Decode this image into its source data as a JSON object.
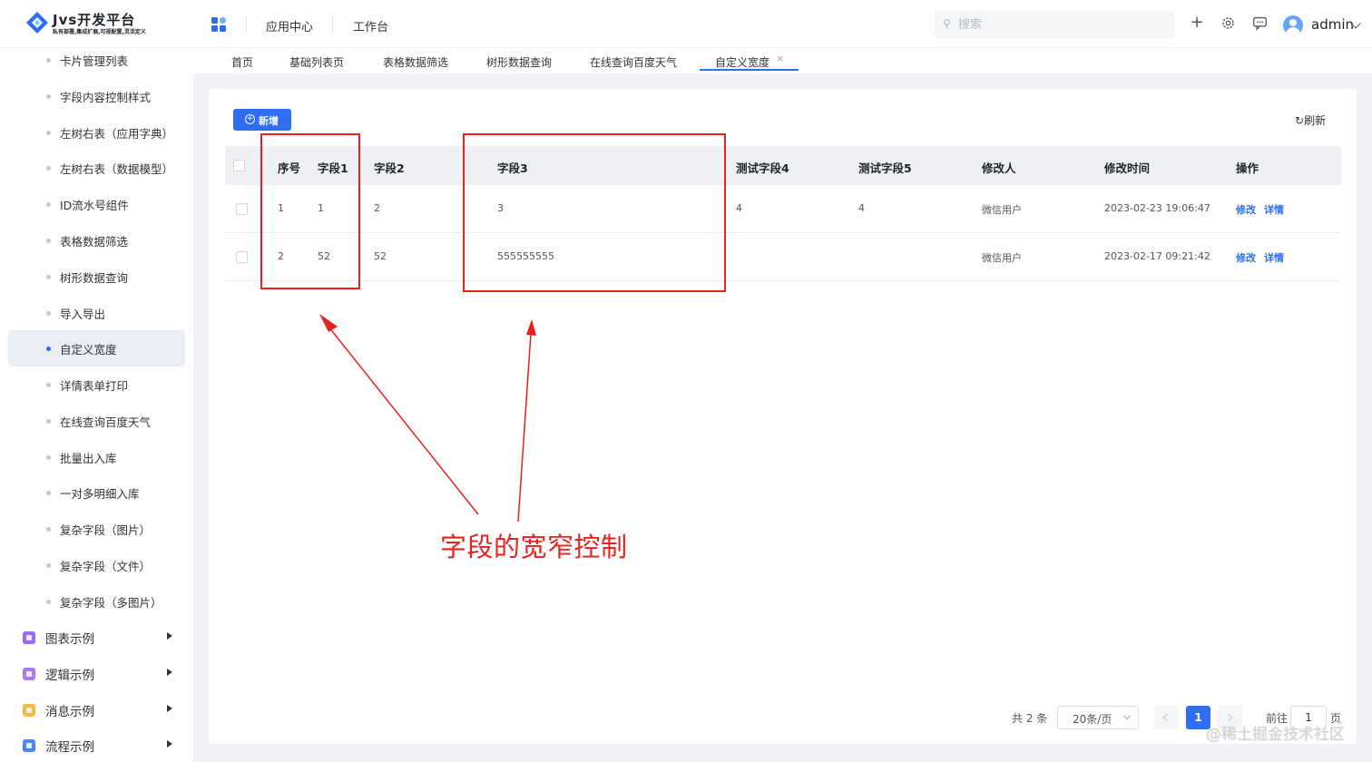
{
  "header": {
    "logo_title": "Jvs开发平台",
    "logo_subtitle": "私有部署,集成扩展,可视配置,灵活定义",
    "nav": [
      "应用中心",
      "工作台"
    ],
    "search_placeholder": "搜索",
    "user_name": "admin",
    "icons": [
      "apps-icon",
      "plus-icon",
      "gear-icon",
      "chat-icon",
      "avatar"
    ]
  },
  "sidebar": {
    "items": [
      {
        "label": "卡片管理列表",
        "active": false
      },
      {
        "label": "字段内容控制样式",
        "active": false
      },
      {
        "label": "左树右表（应用字典）",
        "active": false
      },
      {
        "label": "左树右表（数据模型）",
        "active": false
      },
      {
        "label": "ID流水号组件",
        "active": false
      },
      {
        "label": "表格数据筛选",
        "active": false
      },
      {
        "label": "树形数据查询",
        "active": false
      },
      {
        "label": "导入导出",
        "active": false
      },
      {
        "label": "自定义宽度",
        "active": true
      },
      {
        "label": "详情表单打印",
        "active": false
      },
      {
        "label": "在线查询百度天气",
        "active": false
      },
      {
        "label": "批量出入库",
        "active": false
      },
      {
        "label": "一对多明细入库",
        "active": false
      },
      {
        "label": "复杂字段（图片）",
        "active": false
      },
      {
        "label": "复杂字段（文件）",
        "active": false
      },
      {
        "label": "复杂字段（多图片）",
        "active": false
      }
    ],
    "groups": [
      {
        "label": "图表示例",
        "color": "#9b6cf6"
      },
      {
        "label": "逻辑示例",
        "color": "#a77af6"
      },
      {
        "label": "消息示例",
        "color": "#f7b84a"
      },
      {
        "label": "流程示例",
        "color": "#4c86f5"
      }
    ]
  },
  "tabs": {
    "items": [
      "首页",
      "基础列表页",
      "表格数据筛选",
      "树形数据查询",
      "在线查询百度天气",
      "自定义宽度"
    ],
    "active": "自定义宽度",
    "close_symbol": "×"
  },
  "toolbar": {
    "add_label": "新增",
    "refresh_label": "刷新"
  },
  "table": {
    "columns": [
      "序号",
      "字段1",
      "字段2",
      "字段3",
      "测试字段4",
      "测试字段5",
      "修改人",
      "修改时间",
      "操作"
    ],
    "rows": [
      {
        "seq": "1",
        "f1": "1",
        "f2": "2",
        "f3": "3",
        "f4": "4",
        "f5": "4",
        "modifier": "微信用户",
        "time": "2023-02-23 19:06:47"
      },
      {
        "seq": "2",
        "f1": "52",
        "f2": "52",
        "f3": "555555555",
        "f4": "",
        "f5": "",
        "modifier": "微信用户",
        "time": "2023-02-17 09:21:42"
      }
    ],
    "action_edit": "修改",
    "action_detail": "详情"
  },
  "annotation": {
    "text": "字段的宽窄控制",
    "color": "#e8201e"
  },
  "pagination": {
    "total": "共 2 条",
    "page_size": "20条/页",
    "current_page": "1",
    "goto_label": "前往",
    "goto_value": "1",
    "page_suffix": "页"
  },
  "watermark": "@稀土掘金技术社区",
  "colors": {
    "primary": "#2f6ef2",
    "annotation": "#e8201e"
  }
}
